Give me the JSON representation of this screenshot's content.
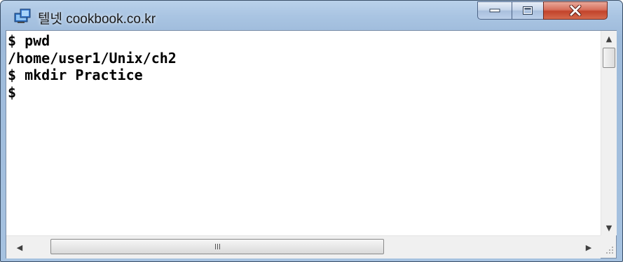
{
  "window": {
    "title": "텔넷 cookbook.co.kr"
  },
  "terminal": {
    "lines": [
      "$ pwd",
      "/home/user1/Unix/ch2",
      "$ mkdir Practice",
      "$"
    ]
  },
  "controls": {
    "minimize_icon": "minimize-icon",
    "maximize_icon": "maximize-icon",
    "close_icon": "close-icon",
    "close_color": "#c2432b"
  },
  "scrollbars": {
    "up_glyph": "▲",
    "down_glyph": "▼",
    "left_glyph": "◀",
    "right_glyph": "▶"
  }
}
